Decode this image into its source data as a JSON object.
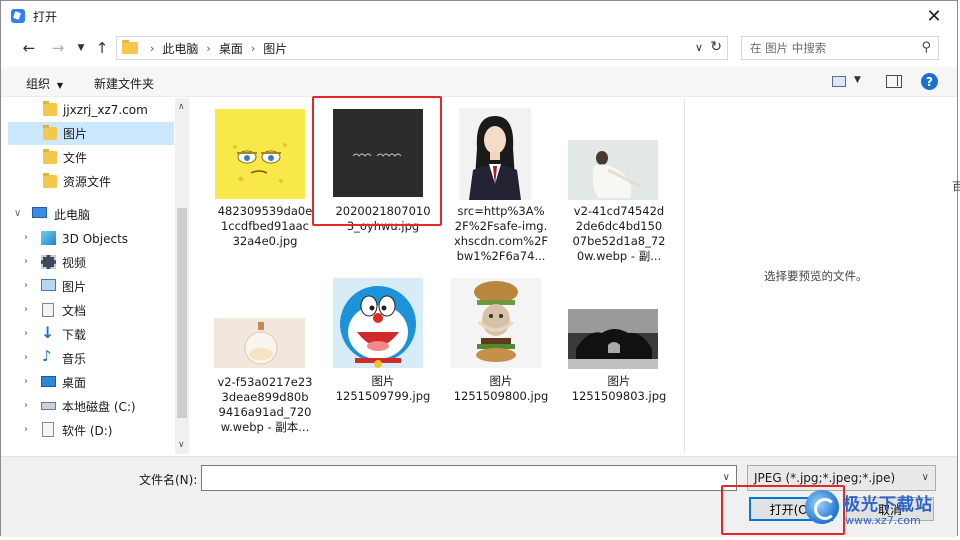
{
  "window": {
    "title": "打开"
  },
  "nav": {
    "breadcrumbs": [
      "此电脑",
      "桌面",
      "图片"
    ],
    "search_placeholder": "在 图片 中搜索"
  },
  "toolbar": {
    "organize": "组织",
    "new_folder": "新建文件夹"
  },
  "sidebar": {
    "items": [
      {
        "label": "jjxzrj_xz7.com",
        "icon": "folder-icon"
      },
      {
        "label": "图片",
        "icon": "folder-icon",
        "selected": true
      },
      {
        "label": "文件",
        "icon": "folder-icon"
      },
      {
        "label": "资源文件",
        "icon": "folder-icon"
      },
      {
        "label": "此电脑",
        "icon": "computer-icon"
      },
      {
        "label": "3D Objects",
        "icon": "cube-icon"
      },
      {
        "label": "视频",
        "icon": "film-icon"
      },
      {
        "label": "图片",
        "icon": "pictures-icon"
      },
      {
        "label": "文档",
        "icon": "document-icon"
      },
      {
        "label": "下载",
        "icon": "download-icon"
      },
      {
        "label": "音乐",
        "icon": "music-icon"
      },
      {
        "label": "桌面",
        "icon": "desktop-icon"
      },
      {
        "label": "本地磁盘 (C:)",
        "icon": "drive-icon"
      },
      {
        "label": "软件 (D:)",
        "icon": "drive-icon"
      }
    ]
  },
  "files": [
    {
      "lines": [
        "482309539da0e",
        "1ccdfbed91aac",
        "32a4e0.jpg"
      ],
      "thumb": "yellow-sponge"
    },
    {
      "lines": [
        "2020021807010",
        "3_oyhwu.jpg"
      ],
      "thumb": "dark-text"
    },
    {
      "lines": [
        "src=http%3A%",
        "2F%2Fsafe-img.",
        "xhscdn.com%2F",
        "bw1%2F6a74..."
      ],
      "thumb": "portrait"
    },
    {
      "lines": [
        "v2-41cd74542d",
        "2de6dc4bd150",
        "07be52d1a8_72",
        "0w.webp - 副..."
      ],
      "thumb": "woman-white"
    },
    {
      "lines": [
        "v2-f53a0217e23",
        "3deae899d80b",
        "9416a91ad_720",
        "w.webp - 副本..."
      ],
      "thumb": "perfume"
    },
    {
      "lines": [
        "图片",
        "1251509799.jpg"
      ],
      "thumb": "doraemon"
    },
    {
      "lines": [
        "图片",
        "1251509800.jpg"
      ],
      "thumb": "cat-burger"
    },
    {
      "lines": [
        "图片",
        "1251509803.jpg"
      ],
      "thumb": "rock-bw"
    }
  ],
  "preview": {
    "empty_text": "选择要预览的文件。"
  },
  "bottom": {
    "filename_label": "文件名(N):",
    "filename_value": "",
    "filter": "JPEG (*.jpg;*.jpeg;*.jpe)",
    "open_button": "打开(O)",
    "cancel_button": "取消"
  },
  "watermark": {
    "title": "极光下载站",
    "url": "www.xz7.com"
  },
  "edge_text": "百"
}
